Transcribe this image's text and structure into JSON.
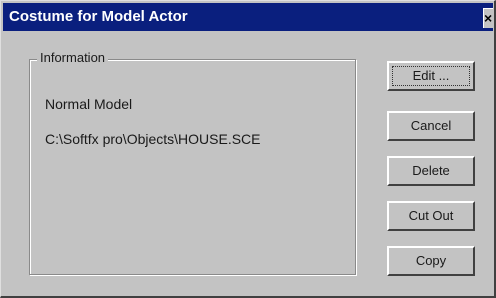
{
  "window": {
    "title": "Costume for Model Actor",
    "close_glyph": "×",
    "close_icon": "close-icon"
  },
  "information": {
    "group_label": "Information",
    "model_type": "Normal Model",
    "file_path": "C:\\Softfx pro\\Objects\\HOUSE.SCE"
  },
  "buttons": {
    "edit": "Edit ...",
    "cancel": "Cancel",
    "delete": "Delete",
    "cut_out": "Cut Out",
    "copy": "Copy"
  },
  "colors": {
    "titlebar": "#0a1f7e",
    "face": "#c3c3c3"
  }
}
